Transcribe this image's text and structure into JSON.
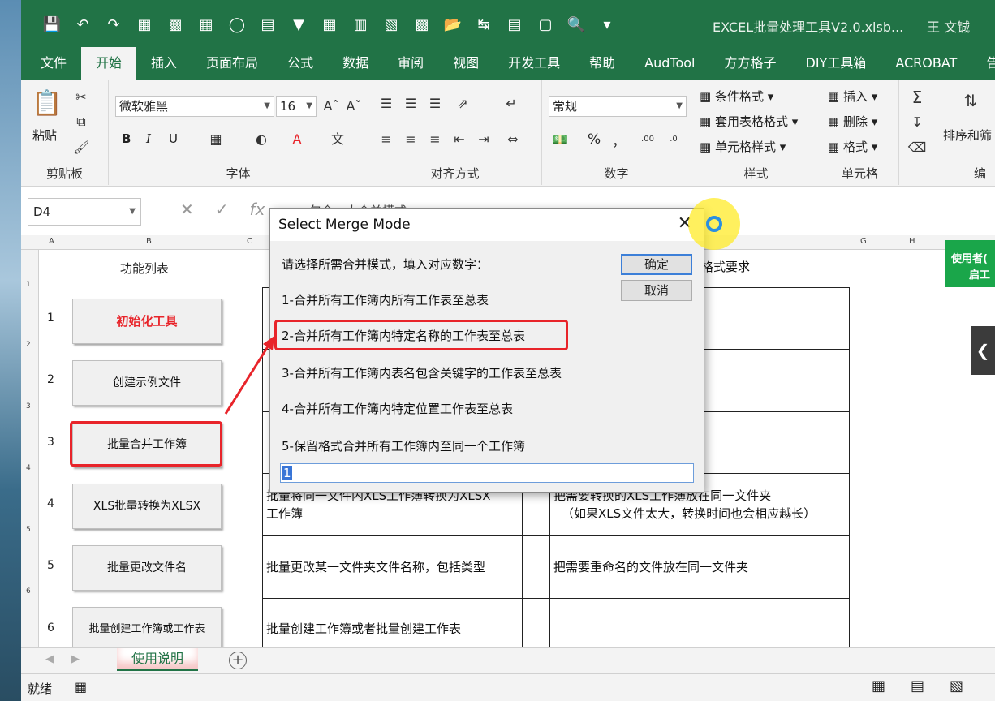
{
  "window": {
    "title": "EXCEL批量处理工具V2.0.xlsb...",
    "user": "王 文铖"
  },
  "quick_access": [
    "save-icon",
    "undo-icon",
    "redo-icon",
    "table-icon",
    "image-icon",
    "filter-icon",
    "circle-icon",
    "print-icon"
  ],
  "ribbon_tabs": [
    "文件",
    "开始",
    "插入",
    "页面布局",
    "公式",
    "数据",
    "审阅",
    "视图",
    "开发工具",
    "帮助",
    "AudTool",
    "方方格子",
    "DIY工具箱",
    "ACROBAT",
    "告"
  ],
  "active_tab": "开始",
  "ribbon": {
    "clipboard": {
      "paste": "粘贴",
      "label": "剪贴板"
    },
    "font": {
      "name": "微软雅黑",
      "size": "16",
      "bold": "B",
      "italic": "I",
      "underline": "U",
      "label": "字体"
    },
    "alignment": {
      "label": "对齐方式"
    },
    "number": {
      "format": "常规",
      "percent": "%",
      "comma": "，",
      "label": "数字"
    },
    "styles": {
      "conditional": "条件格式",
      "table": "套用表格格式",
      "cell": "单元格样式",
      "label": "样式"
    },
    "cells": {
      "insert": "插入",
      "delete": "删除",
      "format": "格式",
      "label": "单元格"
    },
    "editing": {
      "sort": "排序和筛",
      "label": "编"
    }
  },
  "formula_bar": {
    "name_box": "D4",
    "content": "包含…大合并模式"
  },
  "sheet": {
    "column_headers": [
      "A",
      "B",
      "C",
      "G",
      "H"
    ],
    "row_headers": [
      "1",
      "2",
      "3",
      "4",
      "5",
      "6"
    ],
    "func_title": "功能列表",
    "format_header": "格式要求",
    "green_cell": [
      "使用者(",
      "启工"
    ],
    "buttons": [
      {
        "num": "1",
        "label": "初始化工具"
      },
      {
        "num": "2",
        "label": "创建示例文件"
      },
      {
        "num": "3",
        "label": "批量合并工作簿"
      },
      {
        "num": "4",
        "label": "XLS批量转换为XLSX"
      },
      {
        "num": "5",
        "label": "批量更改文件名"
      },
      {
        "num": "6",
        "label": "批量创建工作簿或工作表"
      }
    ],
    "descriptions": [
      {
        "desc": "批量将同一文件内XLS工作簿转换为XLSX工作簿",
        "req": "把需要转换的XLS工作簿放在同一文件夹（如果XLS文件太大，转换时间也会相应越长）"
      },
      {
        "desc": "批量更改某一文件夹文件名称，包括类型",
        "req": "把需要重命名的文件放在同一文件夹"
      },
      {
        "desc": "批量创建工作簿或者批量创建工作表",
        "req": ""
      }
    ],
    "desc_lines": {
      "r4a": "批量将同一文件内XLS工作簿转换为XLSX",
      "r4b": "工作簿",
      "req4a": "把需要转换的XLS工作簿放在同一文件夹",
      "req4b": "（如果XLS文件太大，转换时间也会相应越长）"
    }
  },
  "sheet_tab": "使用说明",
  "status": "就绪",
  "dialog": {
    "title": "Select Merge Mode",
    "prompt": "请选择所需合并模式，填入对应数字：",
    "options": [
      "1-合并所有工作簿内所有工作表至总表",
      "2-合并所有工作簿内特定名称的工作表至总表",
      "3-合并所有工作簿内表名包含关键字的工作表至总表",
      "4-合并所有工作簿内特定位置工作表至总表",
      "5-保留格式合并所有工作簿内至同一个工作簿"
    ],
    "ok": "确定",
    "cancel": "取消",
    "input_value": "1"
  }
}
